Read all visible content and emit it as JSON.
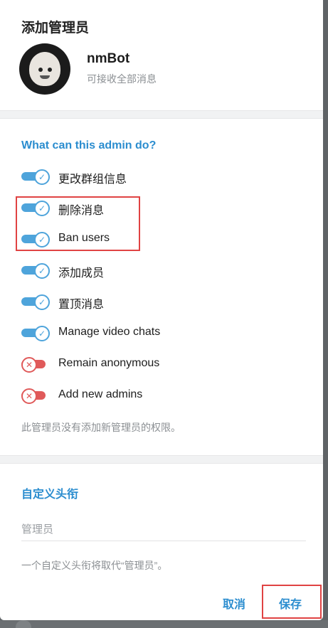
{
  "dialog": {
    "title": "添加管理员",
    "bot_name": "nmBot",
    "bot_status": "可接收全部消息"
  },
  "permissions": {
    "heading": "What can this admin do?",
    "items": [
      {
        "label": "更改群组信息",
        "enabled": true
      },
      {
        "label": "删除消息",
        "enabled": true
      },
      {
        "label": "Ban users",
        "enabled": true
      },
      {
        "label": "添加成员",
        "enabled": true
      },
      {
        "label": "置顶消息",
        "enabled": true
      },
      {
        "label": "Manage video chats",
        "enabled": true
      },
      {
        "label": "Remain anonymous",
        "enabled": false
      },
      {
        "label": "Add new admins",
        "enabled": false
      }
    ],
    "note": "此管理员没有添加新管理员的权限。"
  },
  "custom_title": {
    "heading": "自定义头衔",
    "placeholder": "管理员",
    "note": "一个自定义头衔将取代“管理员”。"
  },
  "buttons": {
    "cancel": "取消",
    "save": "保存"
  },
  "icons": {
    "on": "check-icon",
    "off": "x-icon"
  },
  "colors": {
    "accent": "#2b8dcf",
    "toggle_on": "#4ea4db",
    "toggle_off": "#e05a5a",
    "highlight": "#e04343"
  }
}
